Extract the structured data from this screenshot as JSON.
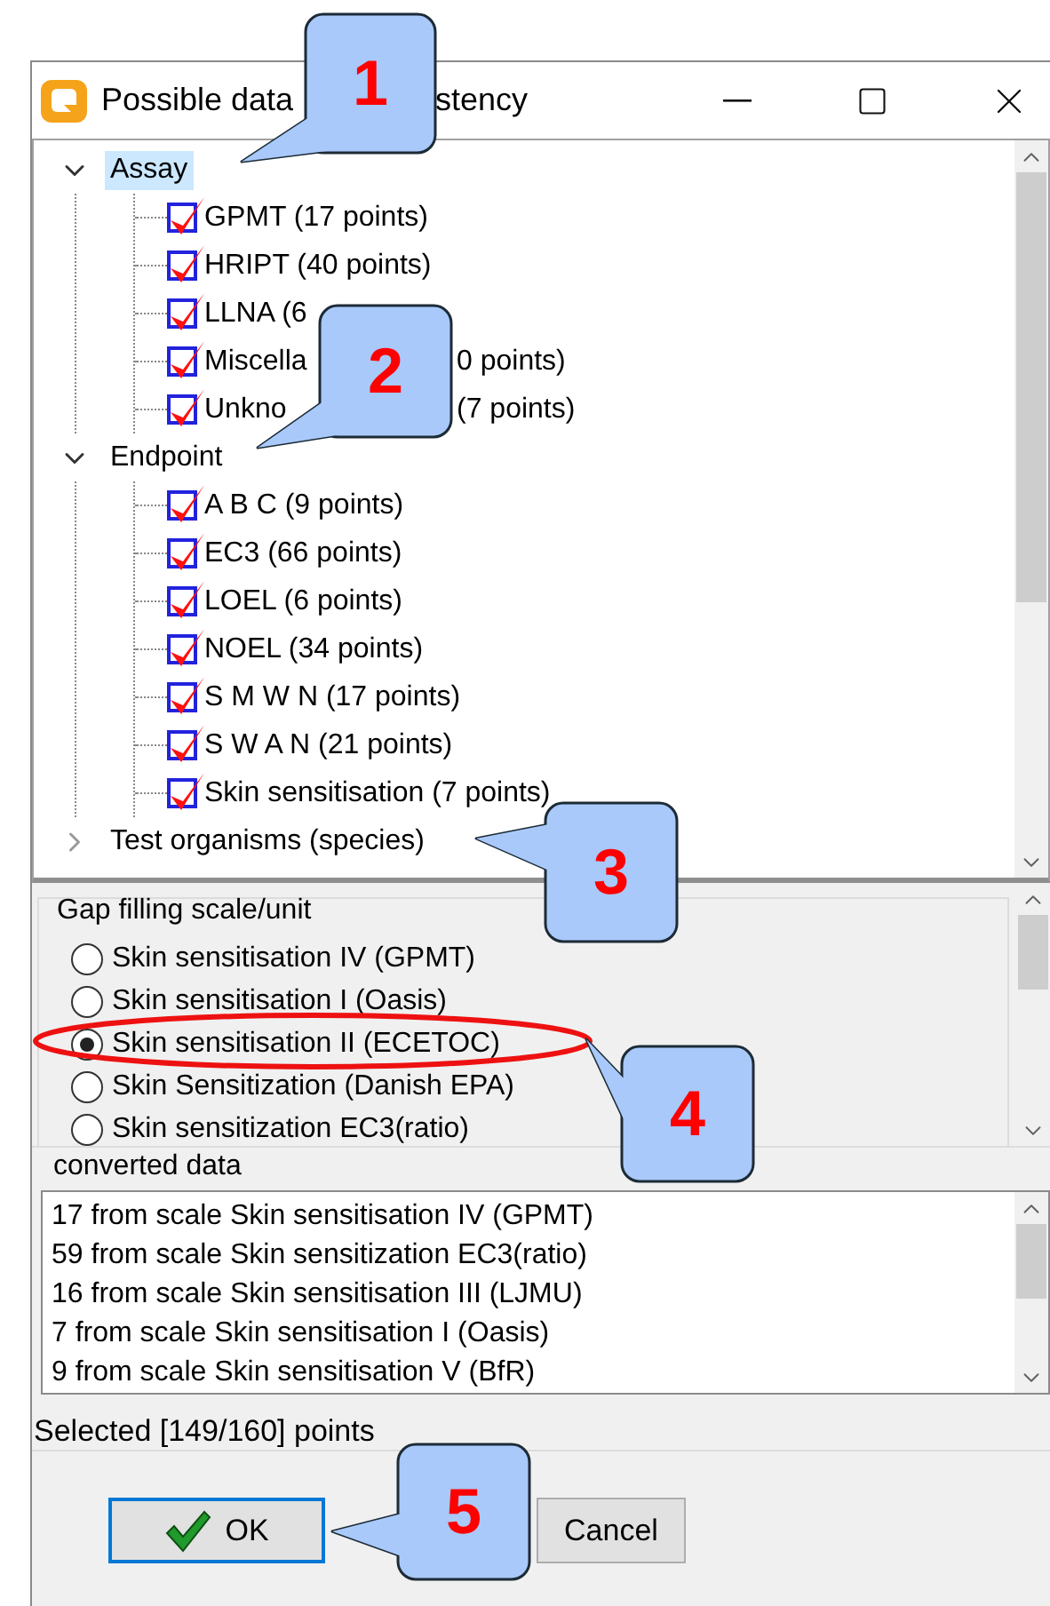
{
  "window": {
    "title_head": "Possible data",
    "title_tail": "stency"
  },
  "tree": [
    {
      "label": "Assay",
      "expanded": true,
      "selected": true,
      "children": [
        {
          "label": "GPMT (17 points)",
          "checked": true
        },
        {
          "label": "HRIPT (40 points)",
          "checked": true
        },
        {
          "label": "LLNA (6",
          "checked": true
        },
        {
          "label": "Miscella",
          "label_tail": "0 points)",
          "checked": true
        },
        {
          "label": "Unkno",
          "label_tail": "(7 points)",
          "checked": true
        }
      ]
    },
    {
      "label": "Endpoint",
      "expanded": true,
      "selected": false,
      "children": [
        {
          "label": "A B C (9 points)",
          "checked": true
        },
        {
          "label": "EC3 (66 points)",
          "checked": true
        },
        {
          "label": "LOEL (6 points)",
          "checked": true
        },
        {
          "label": "NOEL (34 points)",
          "checked": true
        },
        {
          "label": "S M W N (17 points)",
          "checked": true
        },
        {
          "label": "S W A N (21 points)",
          "checked": true
        },
        {
          "label": "Skin sensitisation (7 points)",
          "checked": true
        }
      ]
    },
    {
      "label": "Test organisms (species)",
      "expanded": false,
      "selected": false
    }
  ],
  "scale_group": {
    "title": "Gap filling scale/unit",
    "options": [
      {
        "label": "Skin sensitisation IV (GPMT)",
        "selected": false
      },
      {
        "label": "Skin sensitisation I (Oasis)",
        "selected": false
      },
      {
        "label": "Skin sensitisation II (ECETOC)",
        "selected": true
      },
      {
        "label": "Skin Sensitization (Danish EPA)",
        "selected": false
      },
      {
        "label": "Skin sensitization EC3(ratio)",
        "selected": false
      }
    ]
  },
  "converted": {
    "title": "converted data",
    "rows": [
      "17 from scale Skin sensitisation IV (GPMT)",
      "59 from scale Skin sensitization EC3(ratio)",
      "16 from scale Skin sensitisation III (LJMU)",
      "7 from scale Skin sensitisation I (Oasis)",
      "9 from scale Skin sensitisation V (BfR)"
    ]
  },
  "status": "Selected [149/160] points",
  "buttons": [
    {
      "kind": "ok",
      "label": "OK"
    },
    {
      "kind": "cancel",
      "label": "Cancel"
    }
  ],
  "callouts": [
    {
      "label": "1"
    },
    {
      "label": "2"
    },
    {
      "label": "3"
    },
    {
      "label": "4"
    },
    {
      "label": "5"
    }
  ]
}
